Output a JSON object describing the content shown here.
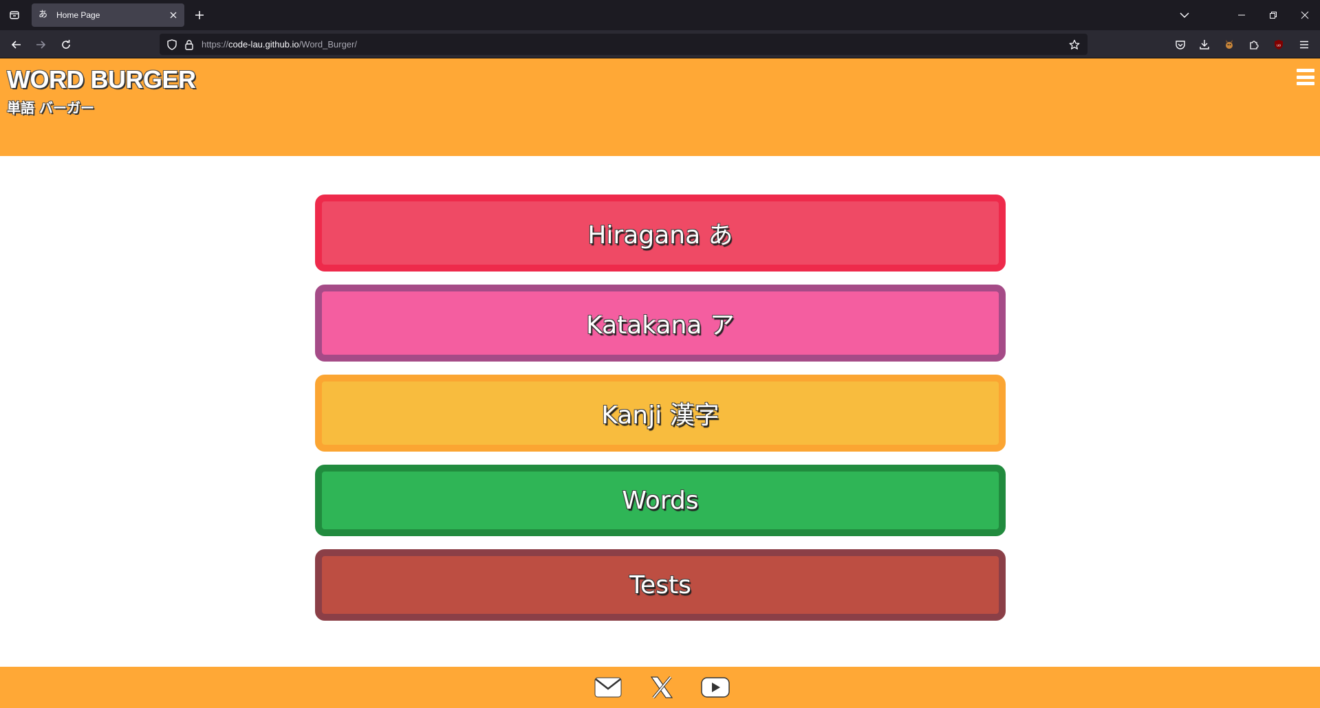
{
  "browser": {
    "tab": {
      "title": "Home Page",
      "favicon": "あ"
    },
    "url": {
      "prefix": "https://",
      "host": "code-lau.github.io",
      "path": "/Word_Burger/"
    }
  },
  "header": {
    "title": "WORD BURGER",
    "subtitle": "単語 バーガー"
  },
  "menu": {
    "items": [
      {
        "label": "Hiragana あ",
        "fill": "#ef4a65",
        "border": "#ee2a4b"
      },
      {
        "label": "Katakana ア",
        "fill": "#f45ea0",
        "border": "#a54b87"
      },
      {
        "label": "Kanji 漢字",
        "fill": "#f8bc3e",
        "border": "#fba532"
      },
      {
        "label": "Words",
        "fill": "#2fb556",
        "border": "#218b3e"
      },
      {
        "label": "Tests",
        "fill": "#bd4e42",
        "border": "#8b3f47"
      }
    ]
  },
  "footer": {
    "icons": [
      "mail-icon",
      "x-icon",
      "youtube-icon"
    ]
  },
  "colors": {
    "brand": "#ffa836",
    "browser_bg": "#1c1b22"
  }
}
